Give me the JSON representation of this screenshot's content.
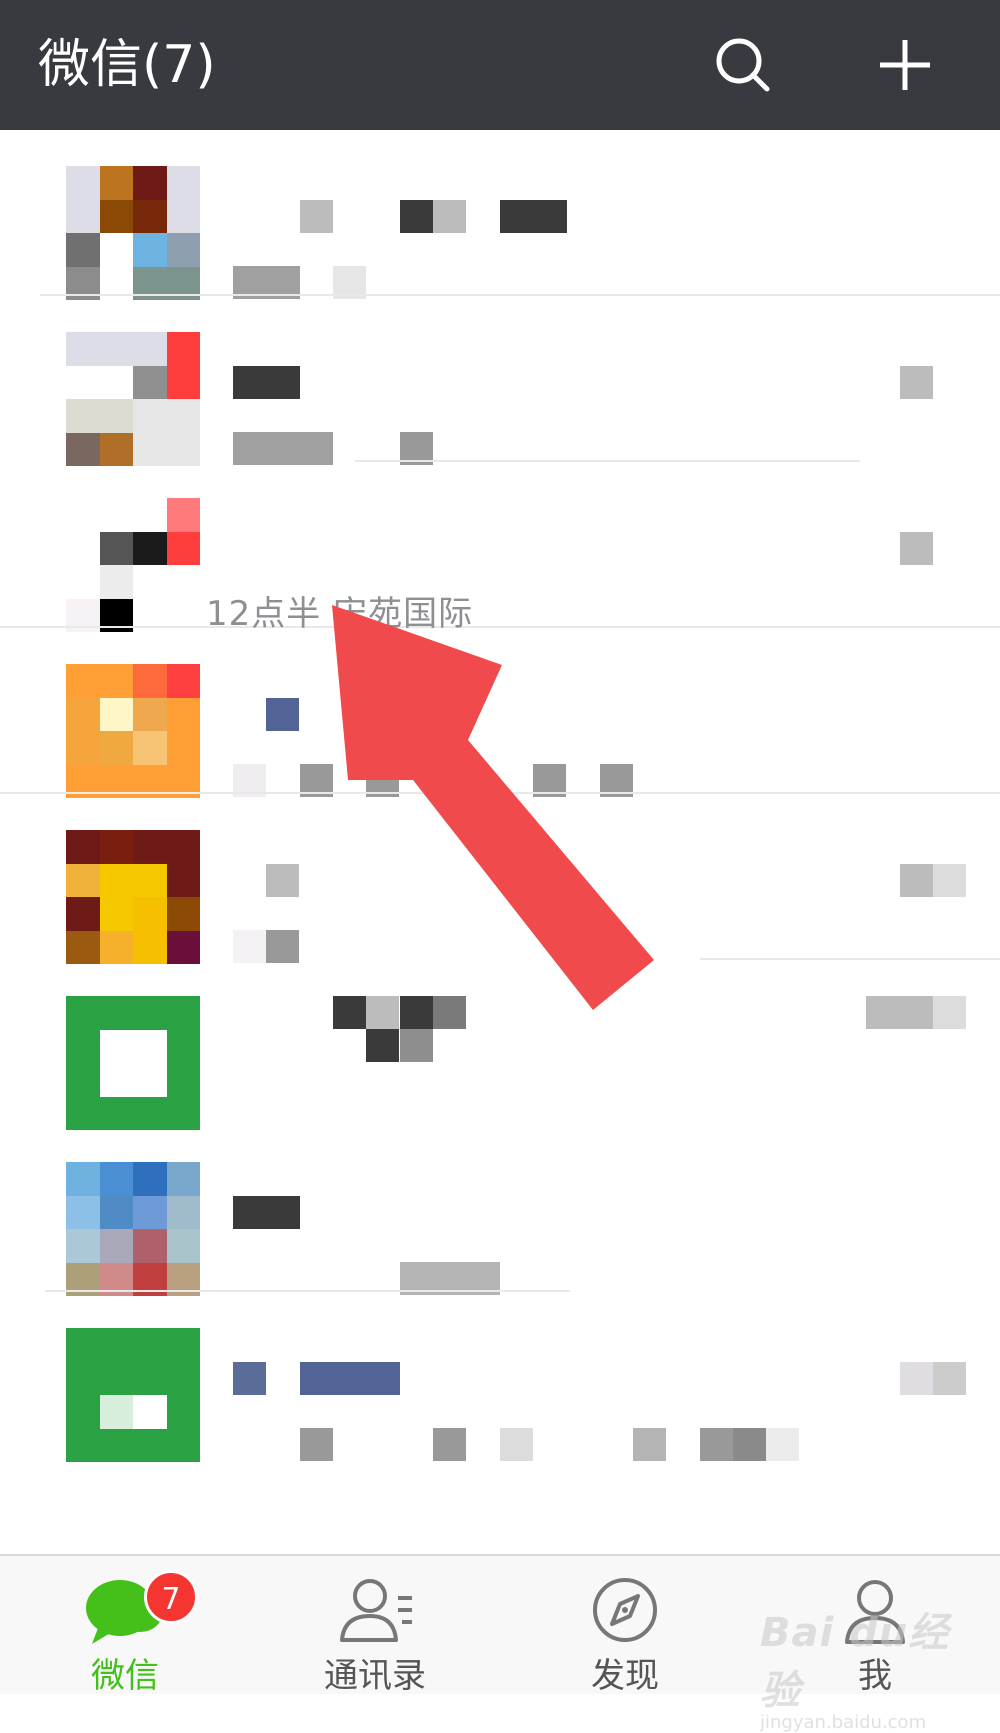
{
  "header": {
    "title": "微信(7)",
    "search_icon": "search-icon",
    "add_icon": "plus-icon",
    "background": "#393a3f"
  },
  "chats": {
    "visible_snippet": "12点半 宋苑国际",
    "note": ""
  },
  "tabbar": {
    "tabs": [
      {
        "label": "微信",
        "icon": "chat-bubbles-icon",
        "active": true,
        "badge": "7"
      },
      {
        "label": "通讯录",
        "icon": "contacts-icon",
        "active": false
      },
      {
        "label": "发现",
        "icon": "compass-icon",
        "active": false
      },
      {
        "label": "我",
        "icon": "profile-icon",
        "active": false
      }
    ],
    "accent": "#45c01a",
    "badge_color": "#f43530"
  },
  "watermark": {
    "line1": "Bai du经验",
    "line2": "jingyan.baidu.com"
  }
}
